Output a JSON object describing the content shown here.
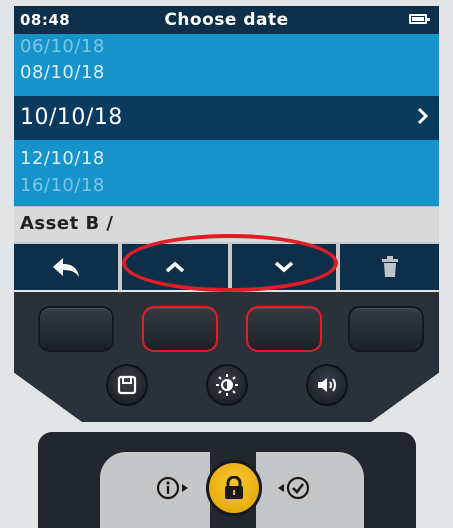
{
  "status_bar": {
    "time": "08:48",
    "title": "Choose date",
    "battery_icon": "battery-icon"
  },
  "date_list": {
    "items": [
      "06/10/18",
      "08/10/18",
      "10/10/18",
      "12/10/18",
      "16/10/18"
    ],
    "selected": "10/10/18"
  },
  "path": "Asset B /",
  "softkeys": [
    {
      "icon": "back-arrow-icon"
    },
    {
      "icon": "chevron-up-icon"
    },
    {
      "icon": "chevron-down-icon"
    },
    {
      "icon": "trash-icon"
    }
  ],
  "keypad": {
    "round_keys": [
      "save-icon",
      "brightness-icon",
      "volume-icon"
    ]
  },
  "lower_keys": [
    "info-icon",
    "lock-icon",
    "check-icon"
  ],
  "colors": {
    "header": "#0d2f4a",
    "list": "#1793cc",
    "selected": "#0a3a5e",
    "highlight": "#e01e26",
    "lock": "#f2b705"
  }
}
